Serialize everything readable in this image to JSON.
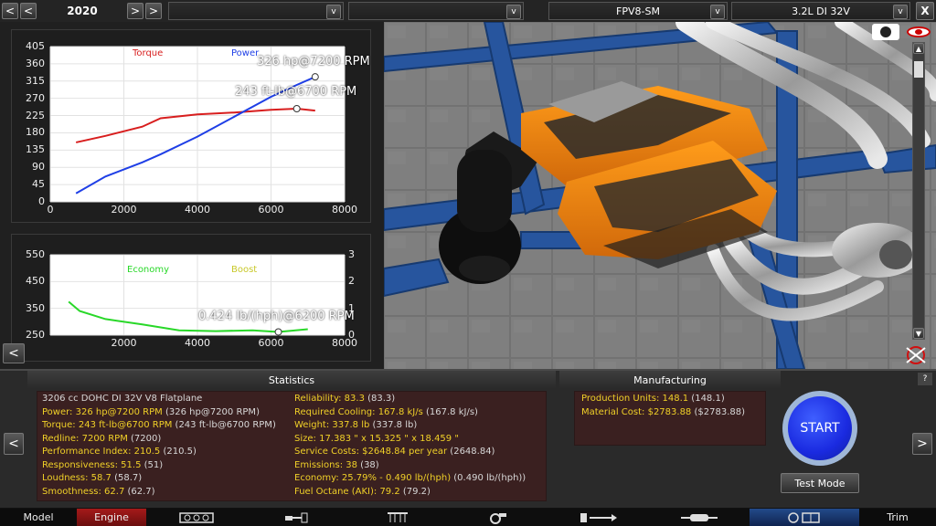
{
  "topbar": {
    "year": "2020",
    "dropdown1_value": "",
    "dropdown2_value": "",
    "family_value": "FPV8-SM",
    "variant_value": "3.2L DI 32V",
    "prev_label": "<",
    "prev2_label": "<",
    "next_label": ">",
    "next2_label": ">",
    "dropdown_arrow": "v",
    "close_label": "X"
  },
  "chart_top": {
    "yticks": [
      "405",
      "360",
      "315",
      "270",
      "225",
      "180",
      "135",
      "90",
      "45",
      "0"
    ],
    "xticks": [
      "0",
      "2000",
      "4000",
      "6000",
      "8000"
    ],
    "legend_torque": "Torque",
    "legend_power": "Power",
    "annotation_power": "326 hp@7200 RPM",
    "annotation_torque": "243 ft-lb@6700 RPM",
    "colors": {
      "torque": "#d81e1e",
      "power": "#1f3fe6"
    }
  },
  "chart_bottom": {
    "yticks_left": [
      "550",
      "450",
      "350",
      "250"
    ],
    "yticks_right": [
      "3",
      "2",
      "1",
      "0"
    ],
    "xticks": [
      "2000",
      "4000",
      "6000",
      "8000"
    ],
    "legend_economy": "Economy",
    "legend_boost": "Boost",
    "annotation": "0.424 lb/(hph)@6200 RPM",
    "colors": {
      "economy": "#28d828",
      "boost": "#c8c828"
    }
  },
  "chart_data": [
    {
      "type": "line",
      "xlim": [
        0,
        8000
      ],
      "ylim": [
        0,
        405
      ],
      "series": [
        {
          "name": "Torque",
          "x": [
            700,
            1500,
            2500,
            3000,
            4000,
            5000,
            6000,
            6700,
            7200
          ],
          "values": [
            155,
            172,
            196,
            218,
            228,
            233,
            240,
            243,
            238
          ]
        },
        {
          "name": "Power",
          "x": [
            700,
            1500,
            2500,
            3000,
            4000,
            5000,
            6000,
            6700,
            7200
          ],
          "values": [
            22,
            66,
            103,
            124,
            170,
            222,
            274,
            305,
            326
          ]
        }
      ]
    },
    {
      "type": "line",
      "xlim": [
        0,
        8000
      ],
      "ylim": [
        250,
        550
      ],
      "series": [
        {
          "name": "Economy",
          "x": [
            500,
            800,
            1500,
            2500,
            3500,
            4500,
            5500,
            6200,
            7000
          ],
          "values": [
            375,
            340,
            310,
            290,
            268,
            265,
            268,
            262,
            272
          ]
        }
      ]
    }
  ],
  "left_nav_arrow": "<",
  "statistics": {
    "title": "Statistics",
    "col1": [
      {
        "text": "3206 cc DOHC DI 32V V8 Flatplane",
        "style": "w"
      },
      {
        "text": "Power: 326 hp@7200 RPM",
        "extra": " (326 hp@7200 RPM)"
      },
      {
        "text": "Torque: 243 ft-lb@6700 RPM",
        "extra": " (243 ft-lb@6700 RPM)"
      },
      {
        "text": "Redline: 7200 RPM",
        "extra": " (7200)"
      },
      {
        "text": "Performance Index: 210.5",
        "extra": " (210.5)"
      },
      {
        "text": "Responsiveness: 51.5",
        "extra": " (51)"
      },
      {
        "text": "Loudness: 58.7",
        "extra": " (58.7)"
      },
      {
        "text": "Smoothness: 62.7",
        "extra": " (62.7)"
      }
    ],
    "col2": [
      {
        "text": "Reliability: 83.3",
        "extra": " (83.3)"
      },
      {
        "text": "Required Cooling: 167.8 kJ/s",
        "extra": " (167.8 kJ/s)"
      },
      {
        "text": "Weight: 337.8 lb",
        "extra": " (337.8 lb)"
      },
      {
        "text": "Size: 17.383 \" x 15.325 \" x 18.459 \"",
        "extra": ""
      },
      {
        "text": "Service Costs: $2648.84 per year",
        "extra": " (2648.84)"
      },
      {
        "text": "Emissions: 38",
        "extra": " (38)"
      },
      {
        "text": "Economy: 25.79% - 0.490 lb/(hph)",
        "extra": " (0.490 lb/(hph))"
      },
      {
        "text": "Fuel Octane (AKI): 79.2",
        "extra": " (79.2)"
      }
    ]
  },
  "manufacturing": {
    "title": "Manufacturing",
    "rows": [
      {
        "text": "Production Units: 148.1",
        "extra": " (148.1)"
      },
      {
        "text": "Material Cost: $2783.88",
        "extra": " ($2783.88)"
      }
    ]
  },
  "help_label": "?",
  "start_label": "START",
  "test_mode_label": "Test Mode",
  "bottom_nav": {
    "model": "Model",
    "engine": "Engine",
    "trim": "Trim"
  }
}
